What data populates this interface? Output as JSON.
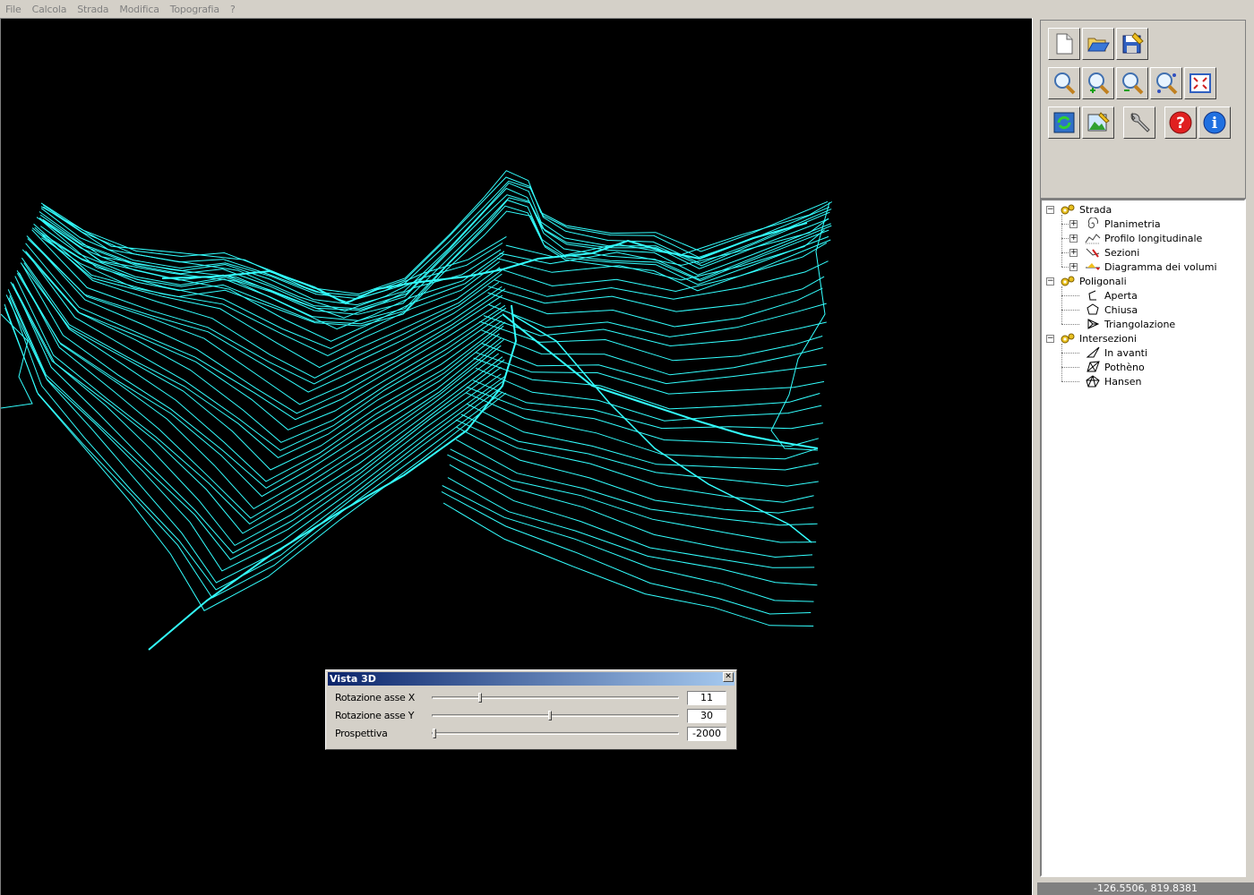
{
  "menu": [
    "File",
    "Calcola",
    "Strada",
    "Modifica",
    "Topografia",
    "?"
  ],
  "colors": {
    "viewport_bg": "#000000",
    "contour_line": "#33ffff",
    "panel_bg": "#d4d0c8",
    "title_gradient_start": "#0a246a",
    "title_gradient_end": "#a6caf0"
  },
  "toolbar": {
    "rows": [
      [
        "new-document-icon",
        "open-folder-icon",
        "save-icon"
      ],
      [
        "zoom-window-icon",
        "zoom-in-icon",
        "zoom-out-icon",
        "zoom-dynamic-icon",
        "zoom-extents-icon"
      ],
      [
        "regenerate-icon",
        "render-image-icon",
        "settings-wrench-icon",
        "help-icon",
        "info-icon"
      ]
    ]
  },
  "tree": {
    "groups": [
      {
        "label": "Strada",
        "icon": "gear-cluster-icon",
        "children": [
          {
            "label": "Planimetria",
            "icon": "spiral-icon"
          },
          {
            "label": "Profilo longitudinale",
            "icon": "profile-icon"
          },
          {
            "label": "Sezioni",
            "icon": "section-icon"
          },
          {
            "label": "Diagramma dei volumi",
            "icon": "volume-diagram-icon"
          }
        ]
      },
      {
        "label": "Poligonali",
        "icon": "gear-cluster-icon",
        "children": [
          {
            "label": "Aperta",
            "icon": "open-polygon-icon"
          },
          {
            "label": "Chiusa",
            "icon": "closed-polygon-icon"
          },
          {
            "label": "Triangolazione",
            "icon": "triangulation-icon"
          }
        ]
      },
      {
        "label": "Intersezioni",
        "icon": "gear-cluster-icon",
        "children": [
          {
            "label": "In avanti",
            "icon": "forward-intersection-icon"
          },
          {
            "label": "Pothèno",
            "icon": "pothenot-icon"
          },
          {
            "label": "Hansen",
            "icon": "hansen-icon"
          }
        ]
      }
    ]
  },
  "status": {
    "coordinates": "-126.5506,  819.8381"
  },
  "dialog": {
    "title": "Vista  3D",
    "close_label": "✕",
    "rows": [
      {
        "label": "Rotazione asse X",
        "value": "11",
        "position": 0.19
      },
      {
        "label": "Rotazione asse Y",
        "value": "30",
        "position": 0.48
      },
      {
        "label": "Prospettiva",
        "value": "-2000",
        "position": 0.0
      }
    ]
  }
}
